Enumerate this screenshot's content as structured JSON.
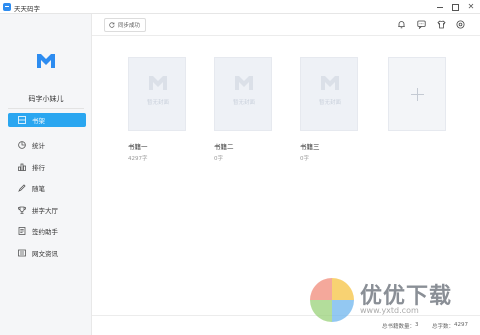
{
  "window": {
    "title": "天天码字"
  },
  "sidebar": {
    "username": "码字小妹儿",
    "items": [
      {
        "label": "书架",
        "icon": "bookshelf-icon",
        "active": true
      },
      {
        "label": "统计",
        "icon": "pie-chart-icon",
        "active": false
      },
      {
        "label": "排行",
        "icon": "ranking-icon",
        "active": false
      },
      {
        "label": "随笔",
        "icon": "pen-icon",
        "active": false
      },
      {
        "label": "拼字大厅",
        "icon": "trophy-icon",
        "active": false
      },
      {
        "label": "签约助手",
        "icon": "contract-icon",
        "active": false
      },
      {
        "label": "网文资讯",
        "icon": "news-icon",
        "active": false
      }
    ]
  },
  "toolbar": {
    "sync_label": "同步成功",
    "icons": [
      "bell-icon",
      "chat-icon",
      "shirt-icon",
      "settings-icon"
    ]
  },
  "books": [
    {
      "name": "书籍一",
      "words": "4297字",
      "cover_text": "暂无封面"
    },
    {
      "name": "书籍二",
      "words": "0字",
      "cover_text": "暂无封面"
    },
    {
      "name": "书籍三",
      "words": "0字",
      "cover_text": "暂无封面"
    }
  ],
  "status": {
    "book_count_label": "总书籍数量：",
    "book_count": "3",
    "word_count_label": "总字数：",
    "word_count": "4297"
  },
  "watermark": {
    "text": "优优下载",
    "url": "www.yxtd.com"
  },
  "colors": {
    "accent": "#2aa6f0",
    "logo": "#2d8cf0"
  }
}
